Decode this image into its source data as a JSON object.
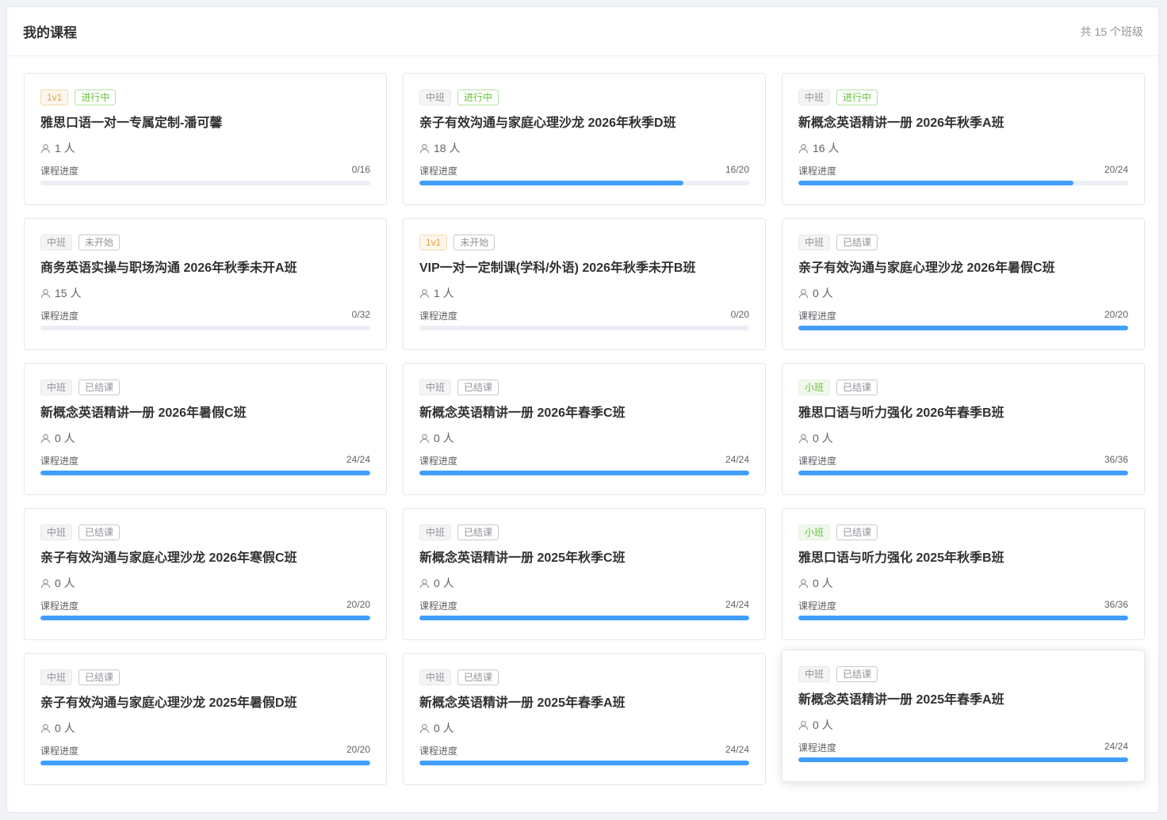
{
  "header": {
    "title": "我的课程",
    "count": "共 15 个班级"
  },
  "colors": {
    "accent": "#409eff",
    "active": "#67c23a",
    "one_on_one": "#e6a23c"
  },
  "cards": [
    {
      "type": "1v1",
      "type_style": "t-1v1",
      "status": "进行中",
      "status_style": "s-active",
      "title": "雅思口语一对一专属定制-潘可馨",
      "people": "1 人",
      "progress_label": "课程进度",
      "progress_text": "0/16",
      "progress": 0
    },
    {
      "type": "中班",
      "type_style": "t-mid",
      "status": "进行中",
      "status_style": "s-active",
      "title": "亲子有效沟通与家庭心理沙龙 2026年秋季D班",
      "people": "18 人",
      "progress_label": "课程进度",
      "progress_text": "16/20",
      "progress": 0.8
    },
    {
      "type": "中班",
      "type_style": "t-mid",
      "status": "进行中",
      "status_style": "s-active",
      "title": "新概念英语精讲一册 2026年秋季A班",
      "people": "16 人",
      "progress_label": "课程进度",
      "progress_text": "20/24",
      "progress": 0.8333
    },
    {
      "type": "中班",
      "type_style": "t-mid",
      "status": "未开始",
      "status_style": "s-plain",
      "title": "商务英语实操与职场沟通 2026年秋季未开A班",
      "people": "15 人",
      "progress_label": "课程进度",
      "progress_text": "0/32",
      "progress": 0
    },
    {
      "type": "1v1",
      "type_style": "t-1v1",
      "status": "未开始",
      "status_style": "s-plain",
      "title": "VIP一对一定制课(学科/外语) 2026年秋季未开B班",
      "people": "1 人",
      "progress_label": "课程进度",
      "progress_text": "0/20",
      "progress": 0
    },
    {
      "type": "中班",
      "type_style": "t-mid",
      "status": "已结课",
      "status_style": "s-plain",
      "title": "亲子有效沟通与家庭心理沙龙 2026年暑假C班",
      "people": "0 人",
      "progress_label": "课程进度",
      "progress_text": "20/20",
      "progress": 1
    },
    {
      "type": "中班",
      "type_style": "t-mid",
      "status": "已结课",
      "status_style": "s-plain",
      "title": "新概念英语精讲一册 2026年暑假C班",
      "people": "0 人",
      "progress_label": "课程进度",
      "progress_text": "24/24",
      "progress": 1
    },
    {
      "type": "中班",
      "type_style": "t-mid",
      "status": "已结课",
      "status_style": "s-plain",
      "title": "新概念英语精讲一册 2026年春季C班",
      "people": "0 人",
      "progress_label": "课程进度",
      "progress_text": "24/24",
      "progress": 1
    },
    {
      "type": "小班",
      "type_style": "t-small",
      "status": "已结课",
      "status_style": "s-plain",
      "title": "雅思口语与听力强化 2026年春季B班",
      "people": "0 人",
      "progress_label": "课程进度",
      "progress_text": "36/36",
      "progress": 1
    },
    {
      "type": "中班",
      "type_style": "t-mid",
      "status": "已结课",
      "status_style": "s-plain",
      "title": "亲子有效沟通与家庭心理沙龙 2026年寒假C班",
      "people": "0 人",
      "progress_label": "课程进度",
      "progress_text": "20/20",
      "progress": 1
    },
    {
      "type": "中班",
      "type_style": "t-mid",
      "status": "已结课",
      "status_style": "s-plain",
      "title": "新概念英语精讲一册 2025年秋季C班",
      "people": "0 人",
      "progress_label": "课程进度",
      "progress_text": "24/24",
      "progress": 1
    },
    {
      "type": "小班",
      "type_style": "t-small",
      "status": "已结课",
      "status_style": "s-plain",
      "title": "雅思口语与听力强化 2025年秋季B班",
      "people": "0 人",
      "progress_label": "课程进度",
      "progress_text": "36/36",
      "progress": 1
    },
    {
      "type": "中班",
      "type_style": "t-mid",
      "status": "已结课",
      "status_style": "s-plain",
      "title": "亲子有效沟通与家庭心理沙龙 2025年暑假D班",
      "people": "0 人",
      "progress_label": "课程进度",
      "progress_text": "20/20",
      "progress": 1
    },
    {
      "type": "中班",
      "type_style": "t-mid",
      "status": "已结课",
      "status_style": "s-plain",
      "title": "新概念英语精讲一册 2025年春季A班",
      "people": "0 人",
      "progress_label": "课程进度",
      "progress_text": "24/24",
      "progress": 1
    },
    {
      "type": "中班",
      "type_style": "t-mid",
      "status": "已结课",
      "status_style": "s-plain",
      "title": "新概念英语精讲一册 2025年春季A班",
      "people": "0 人",
      "progress_label": "课程进度",
      "progress_text": "24/24",
      "progress": 1,
      "hovered": true
    }
  ]
}
